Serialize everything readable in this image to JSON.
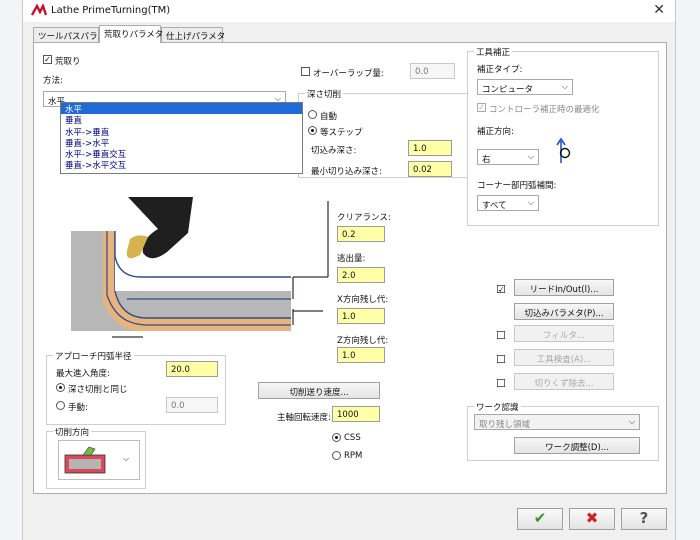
{
  "window": {
    "title": "Lathe PrimeTurning(TM)",
    "close_symbol": "✕"
  },
  "tabs": [
    {
      "label": "ツールパスパラメタ"
    },
    {
      "label": "荒取りパラメタ"
    },
    {
      "label": "仕上げパラメタ"
    }
  ],
  "roughing": {
    "checkbox_label": "荒取り",
    "method_label": "方法:",
    "method_selected": "水平",
    "method_options": [
      "水平",
      "垂直",
      "水平->垂直",
      "垂直->水平",
      "水平->垂直交互",
      "垂直->水平交互"
    ]
  },
  "overlap": {
    "label": "オーバーラップ量:",
    "value": "0.0"
  },
  "depth_of_cut": {
    "group_title": "深さ切削",
    "auto_label": "自動",
    "equal_step_label": "等ステップ",
    "depth_label": "切込み深さ:",
    "depth_value": "1.0",
    "min_depth_label": "最小切り込み深さ:",
    "min_depth_value": "0.02"
  },
  "diagram": {
    "clearance_label": "クリアランス:",
    "clearance_value": "0.2",
    "retract_label": "逃出量:",
    "retract_value": "2.0",
    "x_stock_label": "X方向残し代:",
    "x_stock_value": "1.0",
    "z_stock_label": "Z方向残し代:",
    "z_stock_value": "1.0"
  },
  "approach_arc": {
    "group_title": "アプローチ円弧半径",
    "max_angle_label": "最大進入角度:",
    "max_angle_value": "20.0",
    "same_as_depth_label": "深さ切削と同じ",
    "manual_label": "手動:",
    "manual_value": "0.0"
  },
  "cut_direction": {
    "group_title": "切削方向"
  },
  "feed_button_label": "切削送り速度...",
  "spindle": {
    "label": "主軸回転速度:",
    "value": "1000",
    "css_label": "CSS",
    "rpm_label": "RPM"
  },
  "tool_comp": {
    "group_title": "工具補正",
    "type_label": "補正タイプ:",
    "type_value": "コンピュータ",
    "optimize_label": "コントローラ補正時の最適化",
    "direction_label": "補正方向:",
    "direction_value": "右",
    "corner_label": "コーナー部円弧補間:",
    "corner_value": "すべて"
  },
  "option_buttons": [
    {
      "label": "リードIn/Out(l)...",
      "checkbox": "☑",
      "enabled": true
    },
    {
      "label": "切込みパラメタ(P)...",
      "checkbox": "",
      "enabled": true
    },
    {
      "label": "フィルタ...",
      "checkbox": "☐",
      "enabled": false
    },
    {
      "label": "工具検査(A)...",
      "checkbox": "☐",
      "enabled": false
    },
    {
      "label": "切りくず除去...",
      "checkbox": "☐",
      "enabled": false
    }
  ],
  "stock_recognition": {
    "group_title": "ワーク認識",
    "select_value": "取り残し領域",
    "adjust_button": "ワーク調整(D)..."
  },
  "footer": {
    "ok_symbol": "✔",
    "cancel_symbol": "✖",
    "help_symbol": "?"
  },
  "colors": {
    "accent_yellow": "#ffffa8",
    "ok_green": "#2d9a2d",
    "cancel_red": "#d42020",
    "selection_blue": "#1e6ad6",
    "logo_red": "#c8102e"
  }
}
